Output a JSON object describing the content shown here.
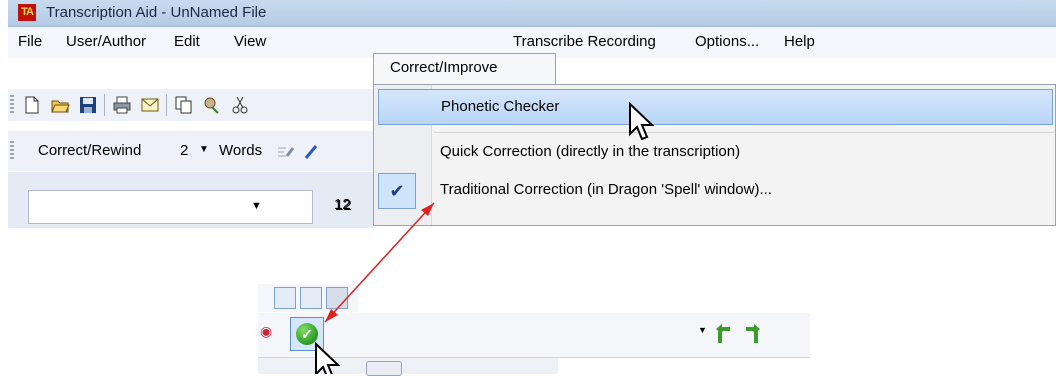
{
  "window": {
    "title": "Transcription Aid - UnNamed File",
    "app_icon_text": "TA"
  },
  "menubar": {
    "items": [
      "File",
      "User/Author",
      "Edit",
      "View",
      "Correct/Improve",
      "Transcribe Recording",
      "Options...",
      "Help"
    ]
  },
  "toolbar2": {
    "correct_rewind_label": "Correct/Rewind",
    "rewind_count": "2",
    "words_label": "Words"
  },
  "font_combo": {
    "font_size": "12"
  },
  "dropdown": {
    "items": [
      {
        "label": "Phonetic Checker",
        "highlighted": true
      },
      {
        "label": "Quick Correction (directly in the transcription)"
      },
      {
        "label": "Traditional Correction (in Dragon 'Spell' window)...",
        "checked": true
      }
    ]
  },
  "colors": {
    "highlight": "#b8d5f6",
    "arrow": "#e02020",
    "check_green": "#2a9a22",
    "title_bar": "#c7daef"
  }
}
